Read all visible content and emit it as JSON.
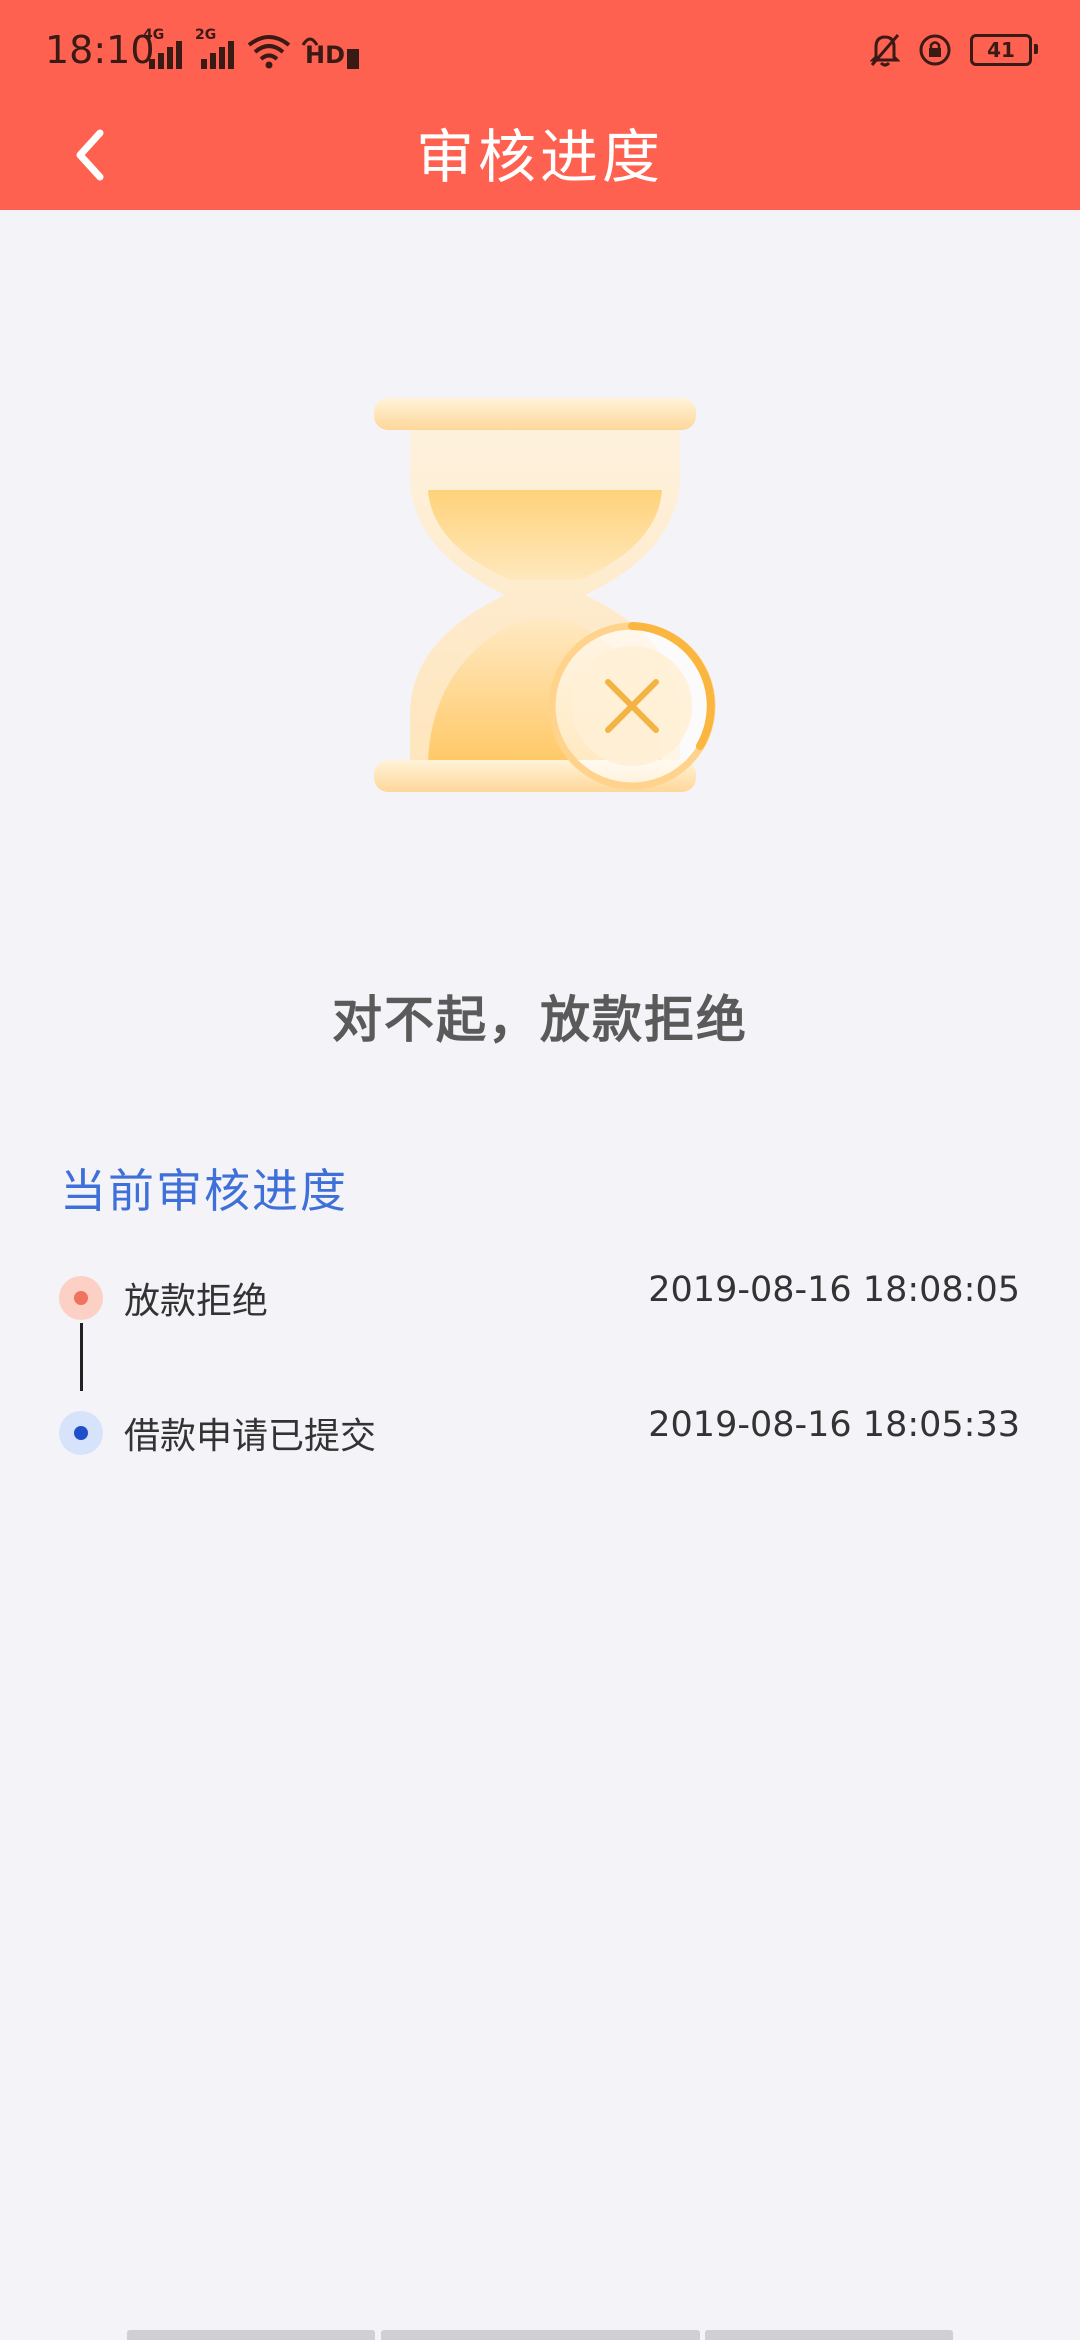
{
  "status_bar": {
    "time": "18:10",
    "signal_1_net": "4G",
    "signal_2_net": "2G",
    "hd_label": "HD",
    "battery_level": "41"
  },
  "header": {
    "title": "审核进度",
    "back_icon": "chevron-left-icon"
  },
  "result": {
    "icon": "hourglass-reject-icon",
    "message": "对不起，放款拒绝"
  },
  "progress": {
    "section_title": "当前审核进度",
    "items": [
      {
        "label": "放款拒绝",
        "time": "2019-08-16 18:08:05",
        "status": "rejected",
        "color": "#f0735e"
      },
      {
        "label": "借款申请已提交",
        "time": "2019-08-16 18:05:33",
        "status": "submitted",
        "color": "#1f4fc9"
      }
    ]
  },
  "colors": {
    "header_bg": "#ff6150",
    "page_bg": "#f4f4f8",
    "section_title": "#3f6fd8",
    "result_text": "#5a5a5a"
  }
}
